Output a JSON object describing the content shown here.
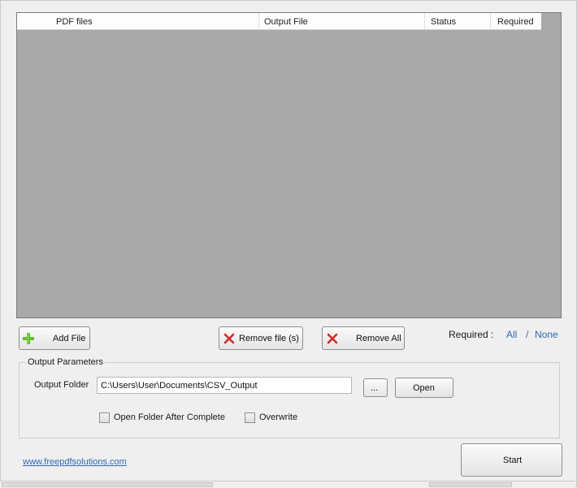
{
  "grid": {
    "columns": [
      "PDF files",
      "Output File",
      "Status",
      "Required"
    ],
    "rows": []
  },
  "toolbar": {
    "add_label": "Add File",
    "remove_label": "Remove file (s)",
    "remove_all_label": "Remove All"
  },
  "required": {
    "label": "Required :",
    "all": "All",
    "separator": "/",
    "none": "None"
  },
  "output_params": {
    "legend": "Output Parameters",
    "folder_label": "Output Folder",
    "folder_value": "C:\\Users\\User\\Documents\\CSV_Output",
    "browse_label": "...",
    "open_label": "Open",
    "open_after_label": "Open Folder After Complete",
    "open_after_checked": false,
    "overwrite_label": "Overwrite",
    "overwrite_checked": false
  },
  "footer": {
    "website": "www.freepdfsolutions.com",
    "start_label": "Start"
  },
  "colors": {
    "grid_bg": "#a9a9a9",
    "link": "#2f69b7",
    "add_icon": "#5fbf2a",
    "remove_icon": "#d42a2a"
  },
  "icons": {
    "add": "plus-icon",
    "remove": "x-icon"
  }
}
